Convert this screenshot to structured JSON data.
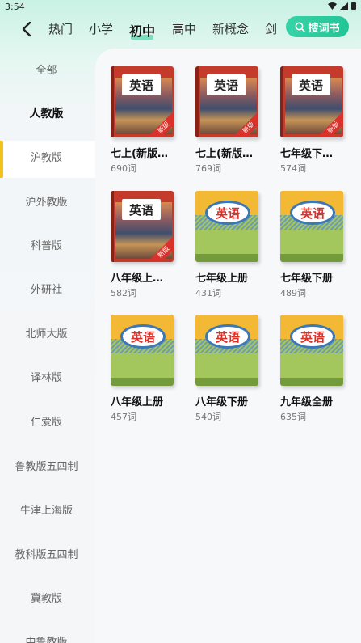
{
  "status": {
    "time": "3:54"
  },
  "tabs": [
    "热门",
    "小学",
    "初中",
    "高中",
    "新概念",
    "剑"
  ],
  "active_tab": "初中",
  "search_button": {
    "label": "搜词书"
  },
  "sidebar": {
    "items": [
      "全部",
      "人教版",
      "沪教版",
      "沪外教版",
      "科普版",
      "外研社",
      "北师大版",
      "译林版",
      "仁爱版",
      "鲁教版五四制",
      "牛津上海版",
      "教科版五四制",
      "冀教版",
      "中鲁教版"
    ],
    "active": "人教版"
  },
  "cover_labels": {
    "english": "英语",
    "new": "新版"
  },
  "books": [
    {
      "name": "七上(新版…",
      "count": "690词",
      "cover": "red"
    },
    {
      "name": "七上(新版…",
      "count": "769词",
      "cover": "red"
    },
    {
      "name": "七年级下…",
      "count": "574词",
      "cover": "red"
    },
    {
      "name": "八年级上…",
      "count": "582词",
      "cover": "red"
    },
    {
      "name": "七年级上册",
      "count": "431词",
      "cover": "green"
    },
    {
      "name": "七年级下册",
      "count": "489词",
      "cover": "green"
    },
    {
      "name": "八年级上册",
      "count": "457词",
      "cover": "green"
    },
    {
      "name": "八年级下册",
      "count": "540词",
      "cover": "green"
    },
    {
      "name": "九年级全册",
      "count": "635词",
      "cover": "green"
    }
  ]
}
